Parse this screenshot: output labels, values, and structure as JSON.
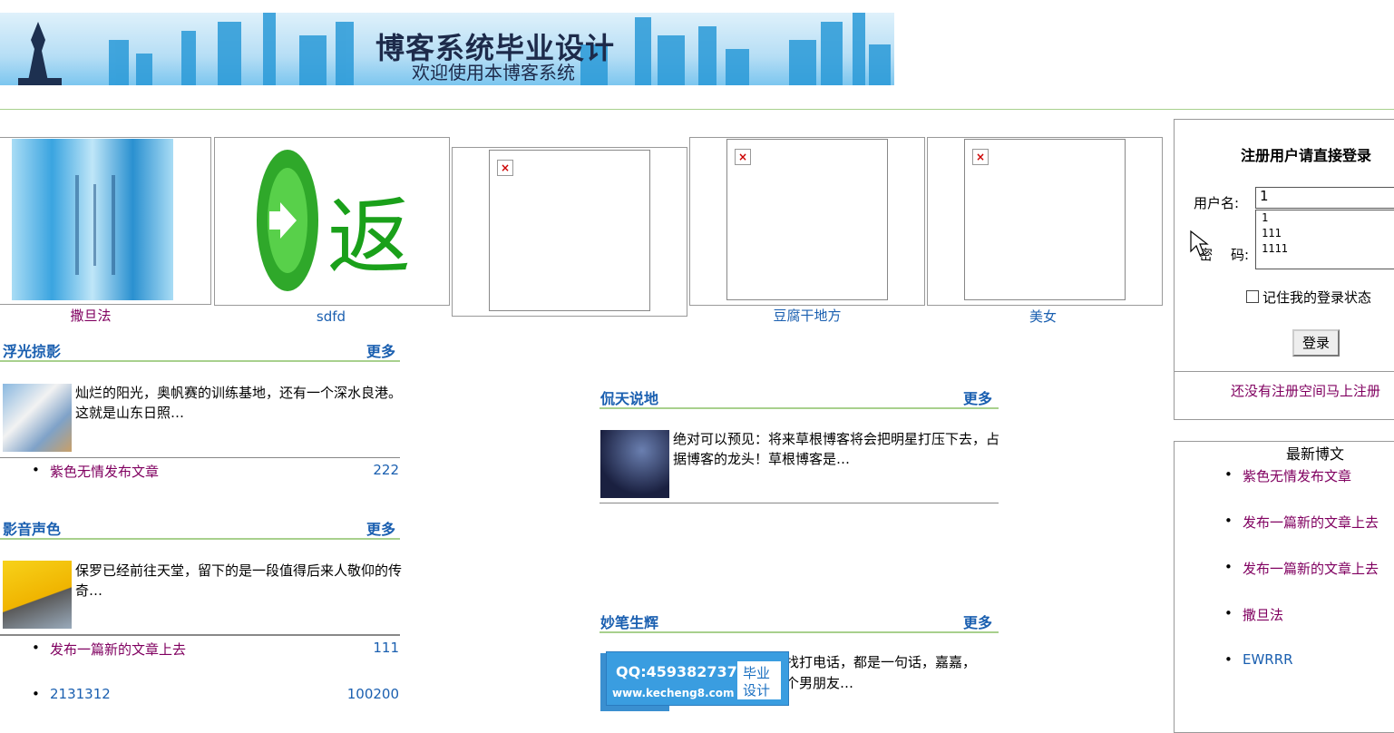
{
  "banner": {
    "title": "博客系统毕业设计",
    "subtitle": "欢迎使用本博客系统"
  },
  "image_strip": [
    {
      "caption": "撒旦法",
      "image": "banner-thumbnail"
    },
    {
      "caption": "sdfd",
      "image": "return-icon"
    },
    {
      "caption": "",
      "image": "broken-image"
    },
    {
      "caption": "豆腐干地方",
      "image": "broken-image"
    },
    {
      "caption": "美女",
      "image": "broken-image"
    }
  ],
  "sections": {
    "fuguang": {
      "title": "浮光掠影",
      "more": "更多",
      "summary": "灿烂的阳光，奥帆赛的训练基地，还有一个深水良港。这就是山东日照…",
      "items": [
        {
          "title": "紫色无情发布文章",
          "count": "222"
        }
      ]
    },
    "yingyin": {
      "title": "影音声色",
      "more": "更多",
      "summary": "保罗已经前往天堂，留下的是一段值得后来人敬仰的传奇…",
      "items": [
        {
          "title": "发布一篇新的文章上去",
          "count": "111"
        },
        {
          "title": "2131312",
          "count": "100200"
        }
      ]
    },
    "kantian": {
      "title": "侃天说地",
      "more": "更多",
      "summary": "绝对可以预见：将来草根博客将会把明星打压下去，占据博客的龙头！草根博客是…"
    },
    "miaobi": {
      "title": "妙笔生辉",
      "more": "更多",
      "summary_line1": "找打电话，都是一句话，嘉嘉，",
      "summary_line2": "个男朋友…"
    }
  },
  "login": {
    "title": "注册用户请直接登录",
    "username_label": "用户名:",
    "username_value": "1",
    "password_label_1": "密",
    "password_label_2": "码:",
    "autocomplete": [
      "1",
      "111",
      "1111"
    ],
    "remember_label": "记住我的登录状态",
    "login_button": "登录",
    "register_link": "还没有注册空间马上注册"
  },
  "latest": {
    "title": "最新博文",
    "items": [
      "紫色无情发布文章",
      "发布一篇新的文章上去",
      "发布一篇新的文章上去",
      "撒旦法",
      "EWRRR"
    ]
  },
  "watermark": {
    "qq": "QQ:459382737",
    "site": "www.kecheng8.com",
    "tag1": "毕业",
    "tag2": "设计"
  }
}
